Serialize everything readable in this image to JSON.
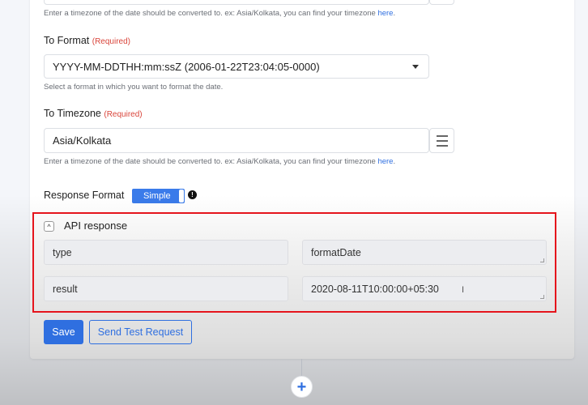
{
  "from_timezone": {
    "help_text": "Enter a timezone of the date should be converted to. ex: Asia/Kolkata, you can find your timezone ",
    "help_link": "here",
    "help_suffix": "."
  },
  "to_format": {
    "label": "To Format",
    "required": "(Required)",
    "value": "YYYY-MM-DDTHH:mm:ssZ (2006-01-22T23:04:05-0000)",
    "help_text": "Select a format in which you want to format the date."
  },
  "to_timezone": {
    "label": "To Timezone",
    "required": "(Required)",
    "value": "Asia/Kolkata",
    "help_text": "Enter a timezone of the date should be converted to. ex: Asia/Kolkata, you can find your timezone ",
    "help_link": "here",
    "help_suffix": "."
  },
  "response_format": {
    "label": "Response Format",
    "toggle_label": "Simple",
    "info_icon": "info-icon"
  },
  "api_response": {
    "title": "API response",
    "collapse_icon": "^",
    "rows": [
      {
        "key": "type",
        "value": "formatDate"
      },
      {
        "key": "result",
        "value": "2020-08-11T10:00:00+05:30"
      }
    ]
  },
  "actions": {
    "save_label": "Save",
    "test_label": "Send Test Request"
  },
  "add_step": {
    "icon": "+"
  },
  "colors": {
    "accent": "#2f6fe0",
    "required": "#d9443a",
    "highlight_border": "#e5141c"
  }
}
